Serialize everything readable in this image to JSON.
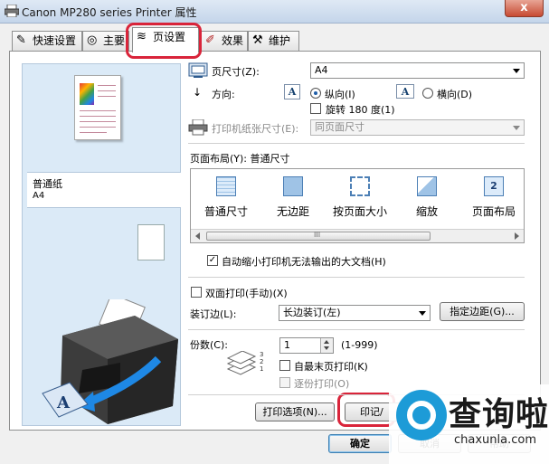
{
  "window": {
    "title": "Canon MP280 series Printer 属性",
    "close_glyph": "x"
  },
  "tabs": [
    {
      "label": "快速设置",
      "icon": "quick-setup-icon"
    },
    {
      "label": "主要",
      "icon": "main-icon"
    },
    {
      "label": "页设置",
      "icon": "page-setup-icon",
      "active": true
    },
    {
      "label": "效果",
      "icon": "effects-icon"
    },
    {
      "label": "维护",
      "icon": "maintenance-icon"
    }
  ],
  "preview": {
    "media_name": "普通纸",
    "media_size": "A4"
  },
  "page_size": {
    "label": "页尺寸(Z):",
    "value": "A4"
  },
  "orientation": {
    "label": "方向:",
    "portrait": "纵向(I)",
    "landscape": "横向(D)",
    "selected": "portrait",
    "icon_letter": "A"
  },
  "rotate": {
    "label": "旋转 180 度(1)",
    "checked": false
  },
  "printer_paper_size": {
    "label": "打印机纸张尺寸(E):",
    "value": "同页面尺寸",
    "disabled": true
  },
  "page_layout": {
    "label": "页面布局(Y): 普通尺寸",
    "items": [
      {
        "label": "普通尺寸",
        "icon": "normal-size-icon"
      },
      {
        "label": "无边距",
        "icon": "borderless-icon"
      },
      {
        "label": "按页面大小",
        "icon": "fit-to-page-icon"
      },
      {
        "label": "缩放",
        "icon": "scaled-icon"
      },
      {
        "label": "页面布局",
        "icon": "page-layout-icon",
        "badge": "2"
      }
    ],
    "scroll_glyph": "III"
  },
  "auto_reduce": {
    "label": "自动缩小打印机无法输出的大文档(H)",
    "checked": true,
    "check_glyph": "✓"
  },
  "duplex": {
    "label": "双面打印(手动)(X)",
    "checked": false
  },
  "stapling_side": {
    "label": "装订边(L):",
    "value": "长边装订(左)",
    "margin_button": "指定边距(G)..."
  },
  "copies": {
    "label": "份数(C):",
    "value": "1",
    "range": "(1-999)",
    "print_last_page_first": "自最末页打印(K)",
    "collate": "逐份打印(O)",
    "stack_glyph": "321"
  },
  "buttons": {
    "print_options": "打印选项(N)...",
    "stamp": "印记/",
    "ok": "确定",
    "cancel": "取消",
    "help": "帮助"
  },
  "watermark": {
    "brand": "查询啦",
    "site": "chaxunla.com"
  },
  "colors": {
    "highlight": "#d9243a",
    "watermark_blue": "#1d9bd7",
    "arrow_blue": "#1e88e5"
  }
}
